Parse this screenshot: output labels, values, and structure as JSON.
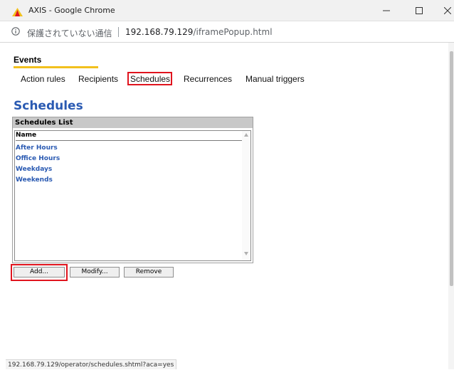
{
  "window": {
    "title": "AXIS - Google Chrome",
    "logo_icon": "axis-logo-icon"
  },
  "address_bar": {
    "security_icon": "info-icon",
    "security_label": "保護されていない通信",
    "url_host": "192.168.79.129",
    "url_path": "/iframePopup.html"
  },
  "events": {
    "title": "Events",
    "tabs": [
      {
        "label": "Action rules"
      },
      {
        "label": "Recipients"
      },
      {
        "label": "Schedules",
        "selected": true
      },
      {
        "label": "Recurrences"
      },
      {
        "label": "Manual triggers"
      }
    ]
  },
  "schedules": {
    "title": "Schedules",
    "list_title": "Schedules List",
    "column_header": "Name",
    "items": [
      "After Hours",
      "Office Hours",
      "Weekdays",
      "Weekends"
    ],
    "buttons": {
      "add": "Add...",
      "modify": "Modify...",
      "remove": "Remove"
    }
  },
  "status_bar": {
    "url": "192.168.79.129/operator/schedules.shtml?aca=yes"
  },
  "colors": {
    "accent_blue": "#2a5ab2",
    "tab_underline": "#f2c01e",
    "highlight_red": "#e0141e"
  }
}
